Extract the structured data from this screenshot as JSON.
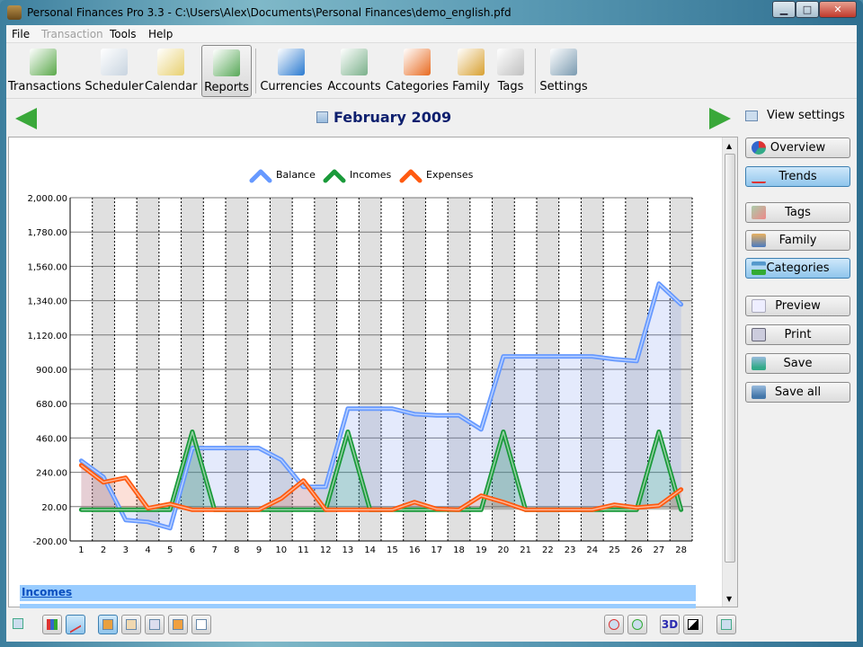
{
  "window": {
    "title": "Personal Finances Pro 3.3 - C:\\Users\\Alex\\Documents\\Personal Finances\\demo_english.pfd",
    "minimize": "▁",
    "maximize": "□",
    "close": "✕"
  },
  "menu": [
    "File",
    "Transaction",
    "Tools",
    "Help"
  ],
  "toolbar": [
    {
      "label": "Transactions",
      "icon": "transactions-icon",
      "color": "#5aa84a"
    },
    {
      "label": "Scheduler",
      "icon": "scheduler-icon",
      "color": "#c8d4e0"
    },
    {
      "label": "Calendar",
      "icon": "calendar-icon",
      "color": "#e8d070"
    },
    {
      "label": "Reports",
      "icon": "reports-icon",
      "color": "#58a858"
    },
    {
      "label": "Currencies",
      "icon": "currencies-icon",
      "color": "#2a7ad0"
    },
    {
      "label": "Accounts",
      "icon": "accounts-icon",
      "color": "#7ab08a"
    },
    {
      "label": "Categories",
      "icon": "categories-icon",
      "color": "#e86a20"
    },
    {
      "label": "Family",
      "icon": "family-icon",
      "color": "#d8a030"
    },
    {
      "label": "Tags",
      "icon": "tags-icon",
      "color": "#c0c0c0"
    },
    {
      "label": "Settings",
      "icon": "settings-icon",
      "color": "#7a9ab0"
    }
  ],
  "nav": {
    "month": "February 2009",
    "view_settings": "View settings"
  },
  "sidebar": {
    "views": [
      "Overview",
      "Trends"
    ],
    "groups": [
      "Tags",
      "Family",
      "Categories"
    ],
    "actions": [
      "Preview",
      "Print",
      "Save",
      "Save all"
    ]
  },
  "section": {
    "incomes": "Incomes"
  },
  "bottom": {
    "label_3d": "3D"
  },
  "colors": {
    "balance": "#6699ff",
    "incomes": "#1a9a3a",
    "expenses": "#ff5a10"
  },
  "chart_data": {
    "type": "line",
    "legend": [
      "Balance",
      "Incomes",
      "Expenses"
    ],
    "legend_position": "top-center",
    "x": [
      1,
      2,
      3,
      4,
      5,
      6,
      7,
      8,
      9,
      10,
      11,
      12,
      13,
      14,
      15,
      16,
      17,
      18,
      19,
      20,
      21,
      22,
      23,
      24,
      25,
      26,
      27,
      28
    ],
    "ylim": [
      -200,
      2000
    ],
    "yticks": [
      "2,000.00",
      "1,780.00",
      "1,560.00",
      "1,340.00",
      "1,120.00",
      "900.00",
      "680.00",
      "460.00",
      "240.00",
      "20.00",
      "-200.00"
    ],
    "ytick_values": [
      2000,
      1780,
      1560,
      1340,
      1120,
      900,
      680,
      460,
      240,
      20,
      -200
    ],
    "series": [
      {
        "name": "Balance",
        "values": [
          314,
          210,
          -66,
          -78,
          -118,
          395,
          395,
          395,
          395,
          320,
          147,
          147,
          648,
          648,
          648,
          613,
          605,
          605,
          515,
          983,
          983,
          983,
          983,
          983,
          965,
          953,
          1449,
          1316
        ]
      },
      {
        "name": "Incomes",
        "values": [
          0,
          0,
          0,
          0,
          0,
          500,
          0,
          0,
          0,
          0,
          0,
          0,
          500,
          0,
          0,
          0,
          0,
          0,
          0,
          500,
          0,
          0,
          0,
          0,
          0,
          0,
          500,
          0
        ]
      },
      {
        "name": "Expenses",
        "values": [
          285,
          176,
          205,
          10,
          37,
          0,
          0,
          0,
          0,
          72,
          187,
          0,
          0,
          0,
          0,
          49,
          5,
          0,
          90,
          49,
          0,
          0,
          0,
          0,
          32,
          14,
          26,
          130
        ]
      }
    ]
  }
}
